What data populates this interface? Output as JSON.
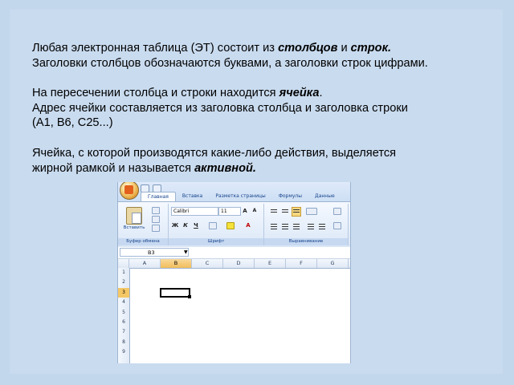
{
  "paragraphs": [
    {
      "lines": [
        [
          {
            "t": "Любая электронная таблица (ЭТ) состоит из ",
            "b": false
          },
          {
            "t": "столбцов",
            "b": true
          },
          {
            "t": " и ",
            "b": false
          },
          {
            "t": "строк.",
            "b": true
          }
        ],
        [
          {
            "t": "Заголовки столбцов обозначаются буквами, а заголовки строк цифрами.",
            "b": false
          }
        ]
      ]
    },
    {
      "lines": [
        [
          {
            "t": "На пересечении столбца и строки находится ",
            "b": false
          },
          {
            "t": "ячейка",
            "b": true
          },
          {
            "t": ".",
            "b": false
          }
        ],
        [
          {
            "t": "Адрес ячейки составляется из заголовка столбца и заголовка строки",
            "b": false
          }
        ],
        [
          {
            "t": " (А1, В6, С25...)",
            "b": false
          }
        ]
      ]
    },
    {
      "lines": [
        [
          {
            "t": "Ячейка, с которой производятся какие-либо действия, выделяется",
            "b": false
          }
        ],
        [
          {
            "t": "жирной рамкой и называется ",
            "b": false
          },
          {
            "t": "активной.",
            "b": true
          }
        ]
      ]
    }
  ],
  "excel": {
    "tabs": [
      "Главная",
      "Вставка",
      "Разметка страницы",
      "Формулы",
      "Данные"
    ],
    "paste_label": "Вставить",
    "groups": {
      "clipboard": "Буфер обмена",
      "font": "Шрифт",
      "alignment": "Выравнивание"
    },
    "font_name": "Calibri",
    "font_size": "11",
    "name_box": "B3",
    "columns": [
      "A",
      "B",
      "C",
      "D",
      "E",
      "F",
      "G"
    ],
    "rows": [
      "1",
      "2",
      "3",
      "4",
      "5",
      "6",
      "7",
      "8",
      "9"
    ],
    "selected_column": "B",
    "selected_row": "3"
  }
}
